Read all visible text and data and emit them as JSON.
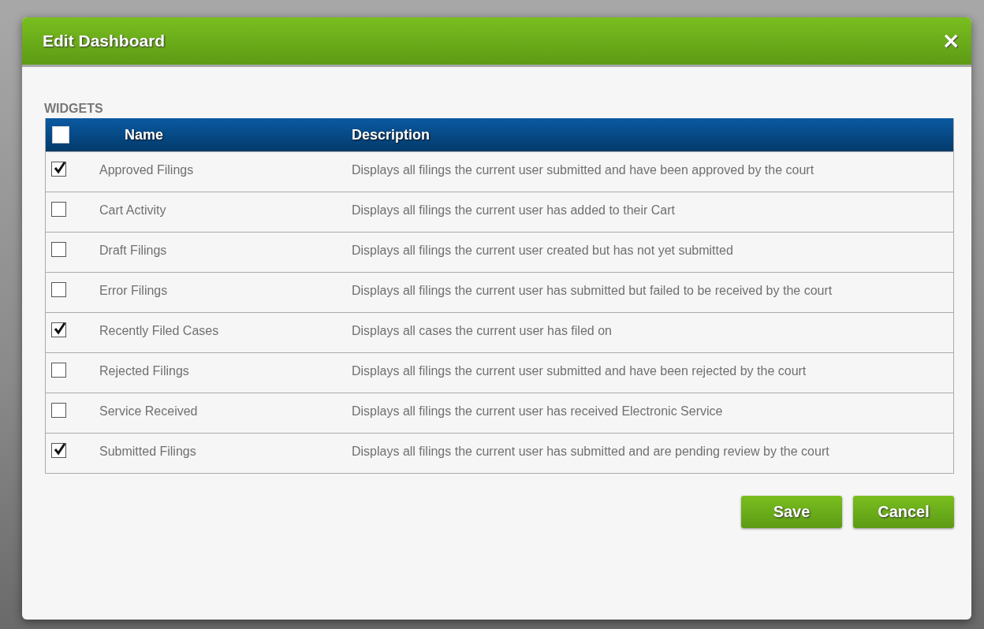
{
  "dialog": {
    "title": "Edit Dashboard",
    "close": "×"
  },
  "section_label": "WIDGETS",
  "table": {
    "select_all": {
      "checked": false
    },
    "columns": [
      "Name",
      "Description"
    ],
    "rows": [
      {
        "name": "Approved Filings",
        "description": "Displays all filings the current user submitted and have been approved by the court",
        "checked": true
      },
      {
        "name": "Cart Activity",
        "description": "Displays all filings the current user has added to their Cart",
        "checked": false
      },
      {
        "name": "Draft Filings",
        "description": "Displays all filings the current user created but has not yet submitted",
        "checked": false
      },
      {
        "name": "Error Filings",
        "description": "Displays all filings the current user has submitted but failed to be received by the court",
        "checked": false
      },
      {
        "name": "Recently Filed Cases",
        "description": "Displays all cases the current user has filed on",
        "checked": true
      },
      {
        "name": "Rejected Filings",
        "description": "Displays all filings the current user submitted and have been rejected by the court",
        "checked": false
      },
      {
        "name": "Service Received",
        "description": "Displays all filings the current user has received Electronic Service",
        "checked": false
      },
      {
        "name": "Submitted Filings",
        "description": "Displays all filings the current user has submitted and are pending review by the court",
        "checked": true
      }
    ]
  },
  "buttons": [
    "Save",
    "Cancel"
  ]
}
